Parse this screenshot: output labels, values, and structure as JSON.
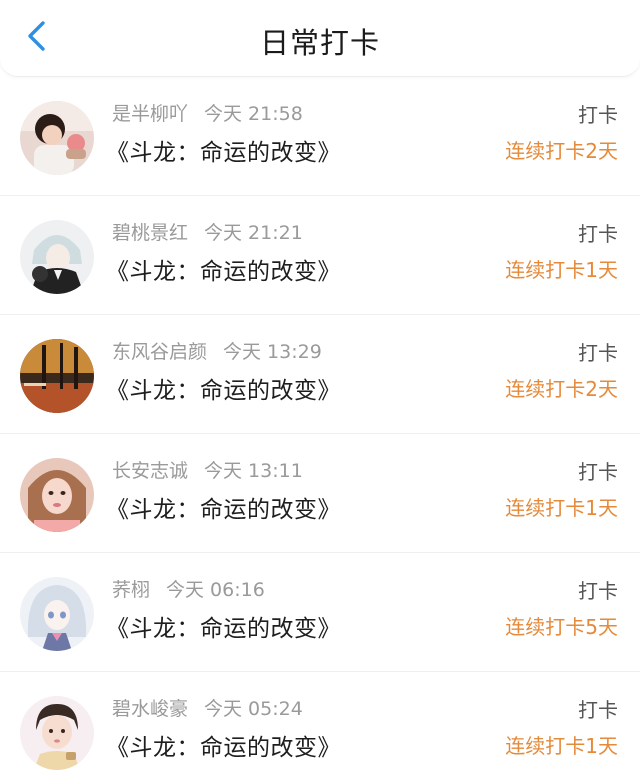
{
  "header": {
    "title": "日常打卡",
    "back_icon": "chevron-left-icon"
  },
  "colors": {
    "accent_blue": "#2f8fe0",
    "streak_orange": "#e58a3a",
    "meta_gray": "#9a9a9a"
  },
  "items": [
    {
      "name": "是半柳吖",
      "time": "今天 21:58",
      "book": "《斗龙：命运的改变》",
      "action": "打卡",
      "streak": "连续打卡2天"
    },
    {
      "name": "碧桃景红",
      "time": "今天 21:21",
      "book": "《斗龙：命运的改变》",
      "action": "打卡",
      "streak": "连续打卡1天"
    },
    {
      "name": "东风谷启颜",
      "time": "今天 13:29",
      "book": "《斗龙：命运的改变》",
      "action": "打卡",
      "streak": "连续打卡2天"
    },
    {
      "name": "长安志诚",
      "time": "今天 13:11",
      "book": "《斗龙：命运的改变》",
      "action": "打卡",
      "streak": "连续打卡1天"
    },
    {
      "name": "荞栩",
      "time": "今天 06:16",
      "book": "《斗龙：命运的改变》",
      "action": "打卡",
      "streak": "连续打卡5天"
    },
    {
      "name": "碧水峻豪",
      "time": "今天 05:24",
      "book": "《斗龙：命运的改变》",
      "action": "打卡",
      "streak": "连续打卡1天"
    }
  ]
}
